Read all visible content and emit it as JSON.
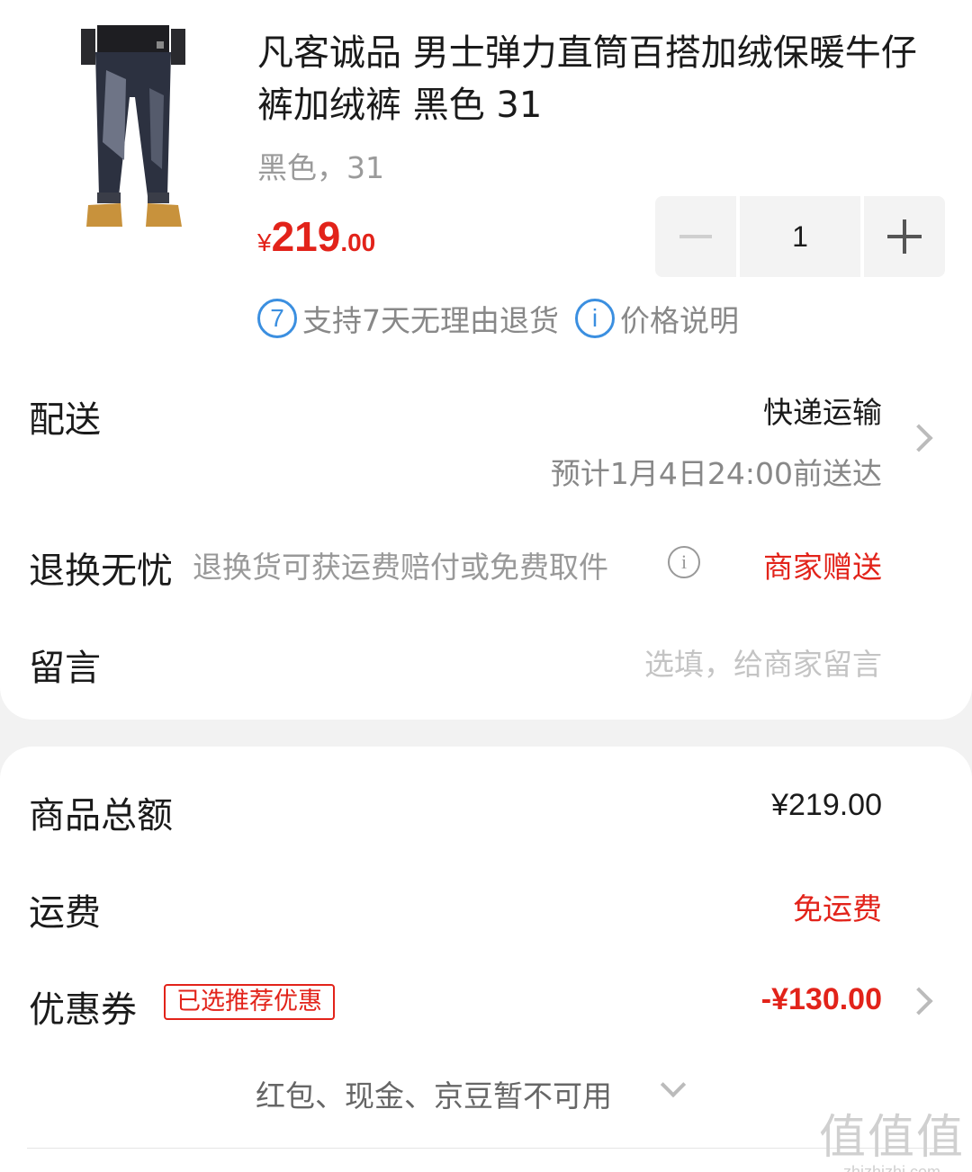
{
  "product": {
    "image": "jeans-model-photo",
    "title": "凡客诚品 男士弹力直筒百搭加绒保暖牛仔裤加绒裤 黑色 31",
    "spec": "黑色，31",
    "price_symbol": "¥",
    "price_int": "219",
    "price_dec": ".00",
    "quantity": "1",
    "badges": [
      {
        "icon": "7",
        "text": "支持7天无理由退货"
      },
      {
        "icon": "i",
        "text": "价格说明"
      }
    ]
  },
  "delivery": {
    "label": "配送",
    "method": "快递运输",
    "eta": "预计1月4日24:00前送达"
  },
  "returns": {
    "label": "退换无忧",
    "desc": "退换货可获运费赔付或免费取件",
    "value": "商家赠送"
  },
  "message": {
    "label": "留言",
    "placeholder": "选填，给商家留言"
  },
  "summary": {
    "goods_total_label": "商品总额",
    "goods_total_value": "¥219.00",
    "shipping_label": "运费",
    "shipping_value": "免运费",
    "coupon_label": "优惠券",
    "coupon_tag": "已选推荐优惠",
    "coupon_value": "-¥130.00",
    "unavailable_text": "红包、现金、京豆暂不可用"
  },
  "watermark": {
    "big": "值值值",
    "small": "zhizhizhi.com"
  },
  "colors": {
    "accent_red": "#e2231a",
    "info_blue": "#3b8fe0"
  }
}
